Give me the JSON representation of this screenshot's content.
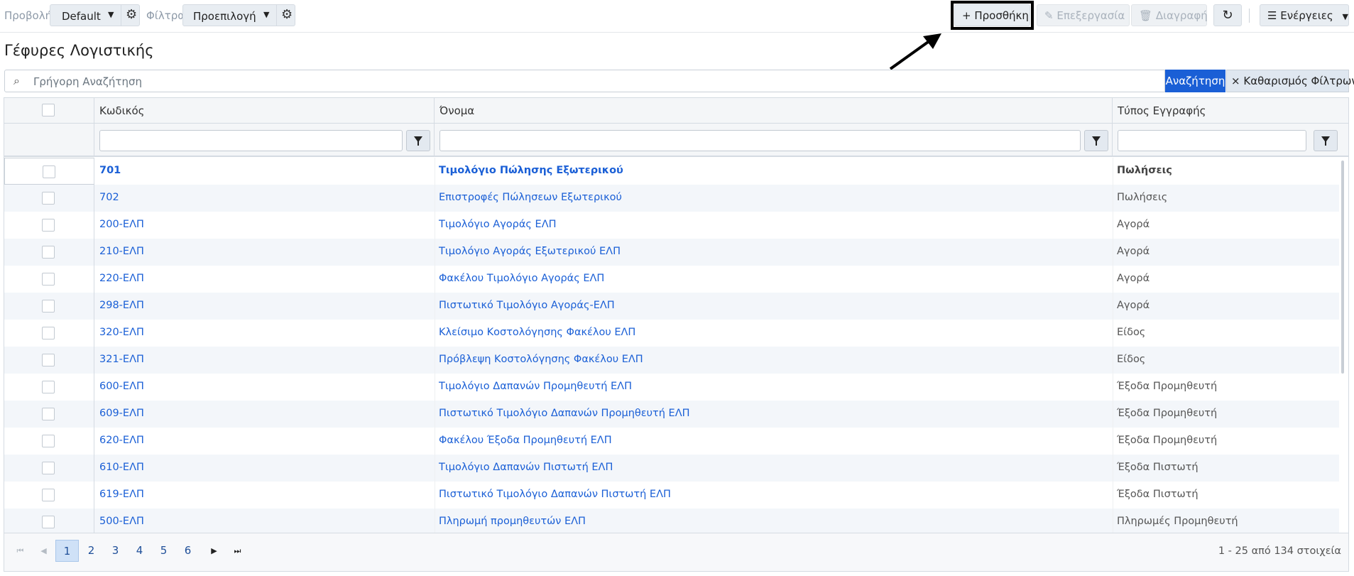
{
  "toolbar": {
    "view_label": "Προβολή",
    "view_value": "Default",
    "filters_label": "Φίλτρα",
    "filters_value": "Προεπιλογή",
    "add_label": "Προσθήκη",
    "edit_label": "Επεξεργασία",
    "delete_label": "Διαγραφή",
    "actions_label": "Ενέργειες"
  },
  "page": {
    "title": "Γέφυρες Λογιστικής"
  },
  "search": {
    "placeholder": "Γρήγορη Αναζήτηση",
    "search_button": "Αναζήτηση",
    "clear_button": "Καθαρισμός Φίλτρων"
  },
  "table": {
    "columns": [
      "Κωδικός",
      "Όνομα",
      "Τύπος Εγγραφής"
    ],
    "rows": [
      {
        "code": "701",
        "name": "Τιμολόγιο Πώλησης Εξωτερικού",
        "type": "Πωλήσεις"
      },
      {
        "code": "702",
        "name": "Επιστροφές Πώλησεων Εξωτερικού",
        "type": "Πωλήσεις"
      },
      {
        "code": "200-ΕΛΠ",
        "name": "Τιμολόγιο Αγοράς ΕΛΠ",
        "type": "Αγορά"
      },
      {
        "code": "210-ΕΛΠ",
        "name": "Τιμολόγιο Αγοράς Εξωτερικού ΕΛΠ",
        "type": "Αγορά"
      },
      {
        "code": "220-ΕΛΠ",
        "name": "Φακέλου Τιμολόγιο Αγοράς ΕΛΠ",
        "type": "Αγορά"
      },
      {
        "code": "298-ΕΛΠ",
        "name": "Πιστωτικό Τιμολόγιο Αγοράς-ΕΛΠ",
        "type": "Αγορά"
      },
      {
        "code": "320-ΕΛΠ",
        "name": "Κλείσιμο Κοστολόγησης Φακέλου ΕΛΠ",
        "type": "Είδος"
      },
      {
        "code": "321-ΕΛΠ",
        "name": "Πρόβλεψη Κοστολόγησης Φακέλου ΕΛΠ",
        "type": "Είδος"
      },
      {
        "code": "600-ΕΛΠ",
        "name": "Τιμολόγιο Δαπανών Προμηθευτή ΕΛΠ",
        "type": "Έξοδα Προμηθευτή"
      },
      {
        "code": "609-ΕΛΠ",
        "name": "Πιστωτικό Τιμολόγιο Δαπανών Προμηθευτή ΕΛΠ",
        "type": "Έξοδα Προμηθευτή"
      },
      {
        "code": "620-ΕΛΠ",
        "name": "Φακέλου Έξοδα Προμηθευτή ΕΛΠ",
        "type": "Έξοδα Προμηθευτή"
      },
      {
        "code": "610-ΕΛΠ",
        "name": "Τιμολόγιο Δαπανών Πιστωτή ΕΛΠ",
        "type": "Έξοδα Πιστωτή"
      },
      {
        "code": "619-ΕΛΠ",
        "name": "Πιστωτικό Τιμολόγιο Δαπανών Πιστωτή ΕΛΠ",
        "type": "Έξοδα Πιστωτή"
      },
      {
        "code": "500-ΕΛΠ",
        "name": "Πληρωμή προμηθευτών ΕΛΠ",
        "type": "Πληρωμές Προμηθευτή"
      }
    ]
  },
  "pager": {
    "pages": [
      "1",
      "2",
      "3",
      "4",
      "5",
      "6"
    ],
    "current": "1",
    "info": "1 - 25 από 134 στοιχεία"
  },
  "colors": {
    "accent": "#1a5fd6",
    "link": "#1a5fd6",
    "row_alt": "#f3f6fa"
  }
}
